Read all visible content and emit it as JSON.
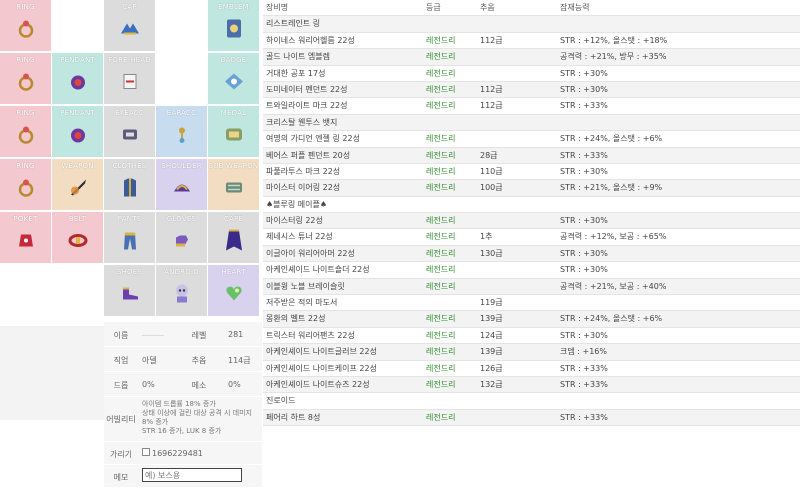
{
  "slots": [
    {
      "label": "RING",
      "color": "pink",
      "icon": "ring-icon"
    },
    {
      "label": "",
      "color": "empty",
      "icon": ""
    },
    {
      "label": "CAP",
      "color": "gray",
      "icon": "cap-icon"
    },
    {
      "label": "",
      "color": "empty",
      "icon": ""
    },
    {
      "label": "EMBLEM",
      "color": "teal",
      "icon": "emblem-icon"
    },
    {
      "label": "RING",
      "color": "pink",
      "icon": "ring-icon"
    },
    {
      "label": "PENDANT",
      "color": "teal",
      "icon": "pendant-icon"
    },
    {
      "label": "FORE HEAD",
      "color": "gray",
      "icon": "forehead-icon"
    },
    {
      "label": "",
      "color": "empty",
      "icon": ""
    },
    {
      "label": "BADGE",
      "color": "teal",
      "icon": "badge-icon"
    },
    {
      "label": "RING",
      "color": "pink",
      "icon": "ring-icon"
    },
    {
      "label": "PENDANT",
      "color": "teal",
      "icon": "pendant-icon"
    },
    {
      "label": "EYEACC",
      "color": "gray",
      "icon": "eye-accessory-icon"
    },
    {
      "label": "EARACC",
      "color": "blue",
      "icon": "earring-icon"
    },
    {
      "label": "MEDAL",
      "color": "teal",
      "icon": "medal-icon"
    },
    {
      "label": "RING",
      "color": "pink",
      "icon": "ring-icon"
    },
    {
      "label": "WEAPON",
      "color": "peach",
      "icon": "weapon-icon"
    },
    {
      "label": "CLOTHES",
      "color": "gray",
      "icon": "clothes-icon"
    },
    {
      "label": "SHOULDER",
      "color": "lav",
      "icon": "shoulder-icon"
    },
    {
      "label": "SUB WEAPON",
      "color": "peach",
      "icon": "subweapon-icon"
    },
    {
      "label": "POKET",
      "color": "pink",
      "icon": "pocket-icon"
    },
    {
      "label": "BELT",
      "color": "pink",
      "icon": "belt-icon"
    },
    {
      "label": "PANTS",
      "color": "gray",
      "icon": "pants-icon"
    },
    {
      "label": "GLOVES",
      "color": "gray",
      "icon": "gloves-icon"
    },
    {
      "label": "CAPE",
      "color": "gray",
      "icon": "cape-icon"
    },
    {
      "label": "",
      "color": "empty",
      "icon": ""
    },
    {
      "label": "",
      "color": "empty",
      "icon": ""
    },
    {
      "label": "SHOES",
      "color": "gray",
      "icon": "shoes-icon"
    },
    {
      "label": "ANDROID",
      "color": "gray",
      "icon": "android-icon"
    },
    {
      "label": "HEART",
      "color": "lav",
      "icon": "heart-icon"
    }
  ],
  "char": {
    "name_label": "이름",
    "name_value": "",
    "level_label": "레벨",
    "level_value": "281",
    "job_label": "직업",
    "job_value": "아델",
    "popularity_label": "추옵",
    "popularity_value": "114급",
    "drop_label": "드롭",
    "drop_value": "0%",
    "meso_label": "메소",
    "meso_value": "0%",
    "ability_label": "어빌리티",
    "ability_lines": [
      "아이템 드롭률 18% 증가",
      "상태 이상에 걸린 대상 공격 시 데미지",
      "8% 증가",
      "STR 16 증가, LUK 8 증가"
    ],
    "power_label": "가리기",
    "power_value": "1696229481",
    "memo_label": "메모",
    "memo_placeholder": "예) 보스용"
  },
  "table": {
    "headers": [
      "장비명",
      "등급",
      "추옵",
      "잠재능력"
    ],
    "rows": [
      {
        "name": "리스트레인트 링",
        "grade": "",
        "add": "",
        "pot": "",
        "alt": true
      },
      {
        "name": "하이네스 워리어헬름 22성",
        "grade": "레전드리",
        "add": "112급",
        "pot": "STR : +12%, 올스탯 : +18%",
        "alt": false
      },
      {
        "name": "골드 나이트 엠블렘",
        "grade": "레전드리",
        "add": "",
        "pot": "공격력 : +21%, 방무 : +35%",
        "alt": true
      },
      {
        "name": "거대한 공포 17성",
        "grade": "레전드리",
        "add": "",
        "pot": "STR : +30%",
        "alt": false
      },
      {
        "name": "도미네이터 펜던트 22성",
        "grade": "레전드리",
        "add": "112급",
        "pot": "STR : +30%",
        "alt": true
      },
      {
        "name": "트와일라이트 마크 22성",
        "grade": "레전드리",
        "add": "112급",
        "pot": "STR : +33%",
        "alt": false
      },
      {
        "name": "크리스탈 웬투스 뱃지",
        "grade": "",
        "add": "",
        "pot": "",
        "alt": true
      },
      {
        "name": "여명의 가디언 엔젤 링 22성",
        "grade": "레전드리",
        "add": "",
        "pot": "STR : +24%, 올스탯 : +6%",
        "alt": false
      },
      {
        "name": "베어스 퍼플 펜던트 20성",
        "grade": "레전드리",
        "add": "28급",
        "pot": "STR : +33%",
        "alt": true
      },
      {
        "name": "파풀라투스 마크 22성",
        "grade": "레전드리",
        "add": "110급",
        "pot": "STR : +30%",
        "alt": false
      },
      {
        "name": "마이스터 이어링 22성",
        "grade": "레전드리",
        "add": "100급",
        "pot": "STR : +21%, 올스탯 : +9%",
        "alt": true
      },
      {
        "name": "♠블루링 메이플♠",
        "grade": "",
        "add": "",
        "pot": "",
        "alt": false
      },
      {
        "name": "마이스터링 22성",
        "grade": "레전드리",
        "add": "",
        "pot": "STR : +30%",
        "alt": true
      },
      {
        "name": "제네시스 튜너 22성",
        "grade": "레전드리",
        "add": "1추",
        "pot": "공격력 : +12%, 보공 : +65%",
        "alt": false
      },
      {
        "name": "이글아이 워리어아머 22성",
        "grade": "레전드리",
        "add": "130급",
        "pot": "STR : +30%",
        "alt": true
      },
      {
        "name": "아케인셰이드 나이트숄더 22성",
        "grade": "레전드리",
        "add": "",
        "pot": "STR : +30%",
        "alt": false
      },
      {
        "name": "이블윙 노블 브레이슬릿",
        "grade": "레전드리",
        "add": "",
        "pot": "공격력 : +21%, 보공 : +40%",
        "alt": true
      },
      {
        "name": "저주받은 적의 마도서",
        "grade": "",
        "add": "119급",
        "pot": "",
        "alt": false
      },
      {
        "name": "몽환의 벨트 22성",
        "grade": "레전드리",
        "add": "139급",
        "pot": "STR : +24%, 올스탯 : +6%",
        "alt": true
      },
      {
        "name": "트릭스터 워리어팬츠 22성",
        "grade": "레전드리",
        "add": "124급",
        "pot": "STR : +30%",
        "alt": false
      },
      {
        "name": "아케인셰이드 나이트글러브 22성",
        "grade": "레전드리",
        "add": "139급",
        "pot": "크뎀 : +16%",
        "alt": true
      },
      {
        "name": "아케인셰이드 나이트케이프 22성",
        "grade": "레전드리",
        "add": "126급",
        "pot": "STR : +33%",
        "alt": false
      },
      {
        "name": "아케인셰이드 나이트슈즈 22성",
        "grade": "레전드리",
        "add": "132급",
        "pot": "STR : +33%",
        "alt": true
      },
      {
        "name": "진로이드",
        "grade": "",
        "add": "",
        "pot": "",
        "alt": false
      },
      {
        "name": "페어리 하트 8성",
        "grade": "레전드리",
        "add": "",
        "pot": "STR : +33%",
        "alt": true
      }
    ]
  }
}
